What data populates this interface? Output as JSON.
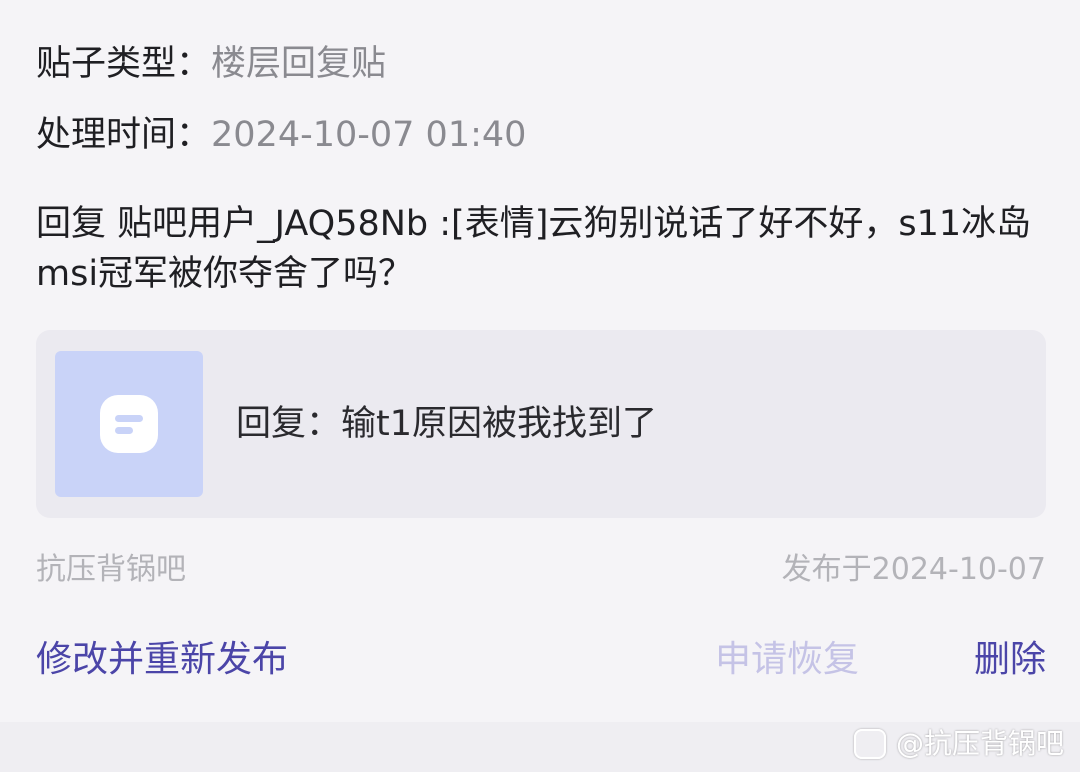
{
  "post_info": {
    "type_label": "贴子类型：",
    "type_value": "楼层回复贴",
    "time_label": "处理时间：",
    "time_value": "2024-10-07 01:40"
  },
  "reply": {
    "text": "回复 贴吧用户_JAQ58Nb :[表情]云狗别说话了好不好，s11冰岛msi冠军被你夺舍了吗？"
  },
  "quote": {
    "thumb_icon": "tieba-post-icon",
    "text": "回复：输t1原因被我找到了"
  },
  "meta": {
    "forum": "抗压背锅吧",
    "published": "发布于2024-10-07"
  },
  "actions": {
    "edit": "修改并重新发布",
    "restore": "申请恢复",
    "delete": "删除"
  },
  "watermark": {
    "text": "@抗压背锅吧"
  },
  "colors": {
    "accent": "#4b45a8",
    "disabled_accent": "#c5c3e6",
    "muted_text": "#8a8a90",
    "card_background": "#ebeaf0",
    "thumb_background": "#c9d3f8"
  }
}
